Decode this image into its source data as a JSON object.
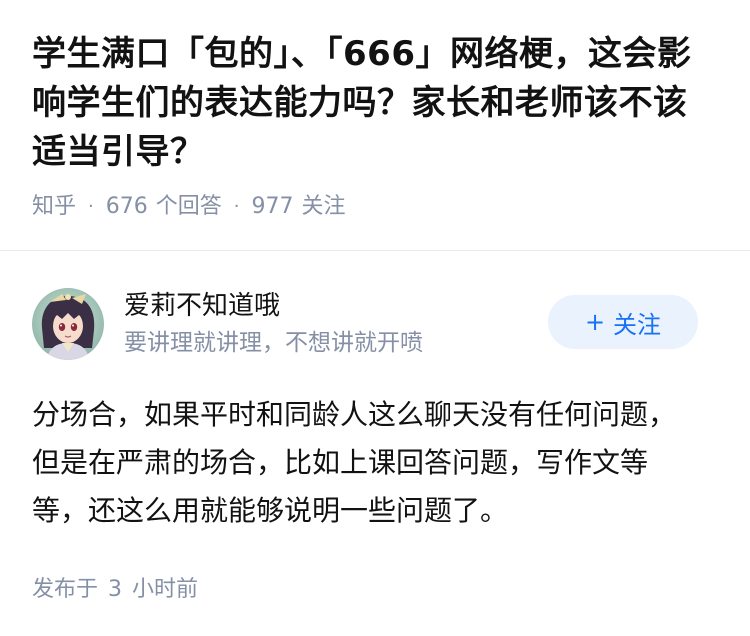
{
  "question": {
    "title": "学生满口「包的」、「666」网络梗，这会影响学生们的表达能力吗？家长和老师该不该适当引导？",
    "source": "知乎",
    "answers_count": "676",
    "answers_label": "个回答",
    "followers_count": "977",
    "followers_label": "关注"
  },
  "answer": {
    "author_name": "爱莉不知道哦",
    "author_headline": "要讲理就讲理，不想讲就开喷",
    "follow_label": "关注",
    "content": "分场合，如果平时和同龄人这么聊天没有任何问题，但是在严肃的场合，比如上课回答问题，写作文等等，还这么用就能够说明一些问题了。",
    "published_prefix": "发布于",
    "published_value": "3",
    "published_suffix": "小时前"
  },
  "colors": {
    "accent": "#1772f6",
    "follow_bg": "#eaf2fd",
    "meta_gray": "#8590a6",
    "text": "#121212"
  },
  "icons": {
    "avatar": "anime-girl-avatar",
    "follow": "plus-icon"
  }
}
